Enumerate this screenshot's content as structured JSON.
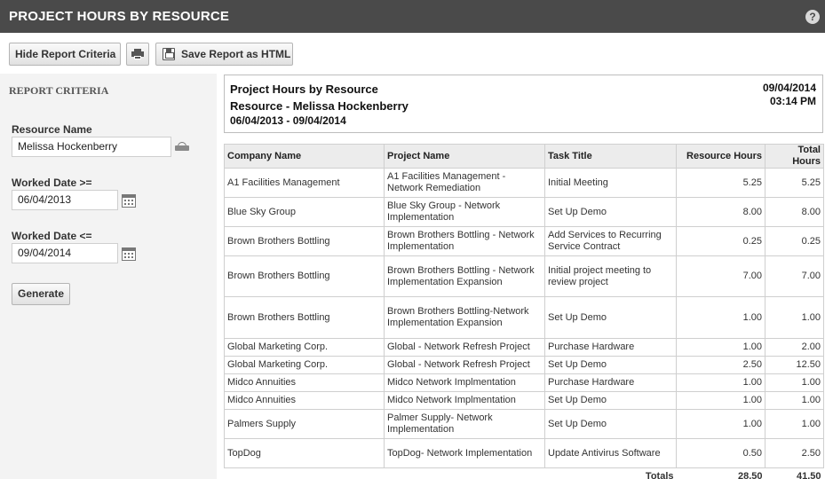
{
  "header": {
    "title": "PROJECT HOURS BY RESOURCE",
    "help_glyph": "?"
  },
  "toolbar": {
    "hide_label": "Hide Report Criteria",
    "save_label": "Save Report as HTML"
  },
  "criteria": {
    "heading": "REPORT CRITERIA",
    "resource_label": "Resource Name",
    "resource_value": "Melissa Hockenberry",
    "from_label": "Worked Date >=",
    "from_value": "06/04/2013",
    "to_label": "Worked Date <=",
    "to_value": "09/04/2014",
    "generate_label": "Generate"
  },
  "report": {
    "title": "Project Hours by Resource",
    "subtitle": "Resource - Melissa Hockenberry",
    "range": "06/04/2013 - 09/04/2014",
    "date": "09/04/2014",
    "time": "03:14 PM",
    "columns": [
      "Company Name",
      "Project Name",
      "Task Title",
      "Resource Hours",
      "Total Hours"
    ],
    "rows": [
      {
        "company": "A1 Facilities Management",
        "project": "A1 Facilities Management - Network Remediation",
        "task": "Initial Meeting",
        "resource_hours": "5.25",
        "total_hours": "5.25"
      },
      {
        "company": "Blue Sky Group",
        "project": "Blue Sky Group - Network Implementation",
        "task": "Set Up Demo",
        "resource_hours": "8.00",
        "total_hours": "8.00"
      },
      {
        "company": "Brown Brothers Bottling",
        "project": "Brown Brothers Bottling - Network Implementation",
        "task": "Add Services to Recurring Service Contract",
        "resource_hours": "0.25",
        "total_hours": "0.25"
      },
      {
        "company": "Brown Brothers Bottling",
        "project": "Brown Brothers Bottling - Network Implementation Expansion",
        "task": "Initial project meeting to review project",
        "resource_hours": "7.00",
        "total_hours": "7.00"
      },
      {
        "company": "Brown Brothers Bottling",
        "project": "Brown Brothers Bottling-Network Implementation Expansion",
        "task": "Set Up Demo",
        "resource_hours": "1.00",
        "total_hours": "1.00"
      },
      {
        "company": "Global Marketing Corp.",
        "project": "Global - Network Refresh Project",
        "task": "Purchase Hardware",
        "resource_hours": "1.00",
        "total_hours": "2.00"
      },
      {
        "company": "Global Marketing Corp.",
        "project": "Global - Network Refresh Project",
        "task": "Set Up Demo",
        "resource_hours": "2.50",
        "total_hours": "12.50"
      },
      {
        "company": "Midco Annuities",
        "project": "Midco Network Implmentation",
        "task": "Purchase Hardware",
        "resource_hours": "1.00",
        "total_hours": "1.00"
      },
      {
        "company": "Midco Annuities",
        "project": "Midco Network Implmentation",
        "task": "Set Up Demo",
        "resource_hours": "1.00",
        "total_hours": "1.00"
      },
      {
        "company": "Palmers Supply",
        "project": "Palmer Supply- Network Implementation",
        "task": "Set Up Demo",
        "resource_hours": "1.00",
        "total_hours": "1.00"
      },
      {
        "company": "TopDog",
        "project": "TopDog- Network Implementation",
        "task": "Update Antivirus Software",
        "resource_hours": "0.50",
        "total_hours": "2.50"
      }
    ],
    "totals_label": "Totals",
    "totals_resource": "28.50",
    "totals_total": "41.50"
  }
}
